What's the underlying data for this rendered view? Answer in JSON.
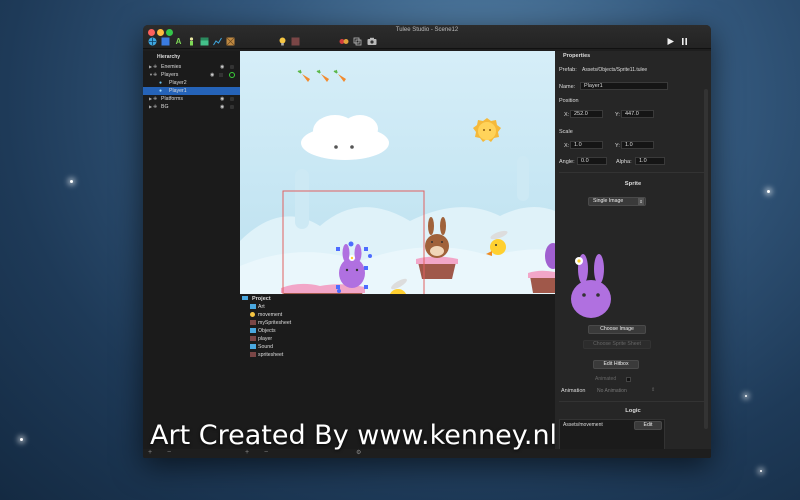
{
  "window": {
    "title": "Tulee Studio - Scene12"
  },
  "toolbar": {
    "tools": [
      {
        "icon": "globe-icon",
        "color": "#3fa7e0"
      },
      {
        "icon": "square-icon",
        "color": "#3a7be0"
      },
      {
        "icon": "letter-a-icon",
        "color": "#7ed957"
      },
      {
        "icon": "figure-icon",
        "color": "#7ed957"
      },
      {
        "icon": "tile-icon",
        "color": "#43c08a"
      },
      {
        "icon": "line-icon",
        "color": "#3fa7e0"
      },
      {
        "icon": "crate-icon",
        "color": "#c08a43"
      }
    ],
    "extra": [
      {
        "icon": "lightbulb-icon",
        "color": "#f5c542"
      },
      {
        "icon": "spritesheet-icon",
        "color": "#7a4646"
      },
      {
        "icon": "collision-icon",
        "color": "#d23c3c"
      },
      {
        "icon": "layers-icon",
        "color": "#bbbbbb"
      },
      {
        "icon": "camera-icon",
        "color": "#bbbbbb"
      }
    ],
    "play_icon": "play-icon",
    "pause_icon": "pause-icon"
  },
  "hierarchy": {
    "title": "Hierarchy",
    "items": [
      {
        "label": "Enemies",
        "level": 0,
        "expandable": true
      },
      {
        "label": "Players",
        "level": 0,
        "expandable": true
      },
      {
        "label": "Player2",
        "level": 1,
        "expandable": false
      },
      {
        "label": "Player1",
        "level": 1,
        "expandable": false,
        "selected": true
      },
      {
        "label": "Platforms",
        "level": 0,
        "expandable": true
      },
      {
        "label": "BG",
        "level": 0,
        "expandable": true
      }
    ]
  },
  "project": {
    "title": "Project",
    "items": [
      {
        "label": "Art",
        "type": "folder"
      },
      {
        "label": "movement",
        "type": "script"
      },
      {
        "label": "mySpritesheet",
        "type": "spritesheet"
      },
      {
        "label": "Objects",
        "type": "folder"
      },
      {
        "label": "player",
        "type": "spritesheet"
      },
      {
        "label": "Sound",
        "type": "folder"
      },
      {
        "label": "spritesheet",
        "type": "spritesheet"
      }
    ]
  },
  "properties": {
    "title": "Properties",
    "prefab_label": "Prefab:",
    "prefab_value": "Assets/Objects/Sprite11.tulee",
    "name_label": "Name:",
    "name_value": "Player1",
    "position_label": "Position",
    "pos_x_label": "X:",
    "pos_x": "252.0",
    "pos_y_label": "Y:",
    "pos_y": "447.0",
    "scale_label": "Scale",
    "scale_x_label": "X:",
    "scale_x": "1.0",
    "scale_y_label": "Y:",
    "scale_y": "1.0",
    "angle_label": "Angle:",
    "angle": "0.0",
    "alpha_label": "Alpha:",
    "alpha": "1.0",
    "sprite_section": "Sprite",
    "sprite_mode": "Single Image",
    "choose_image": "Choose Image",
    "choose_sprite_sheet": "Choose Sprite Sheet",
    "edit_hitbox": "Edit Hitbox",
    "animated_label": "Animated",
    "animation_label": "Animation",
    "animation_value": "No Animation",
    "logic_section": "Logic",
    "logic_script": "Assets/movement",
    "edit_button": "Edit"
  },
  "footer": {
    "plus": "+",
    "minus": "−",
    "gear": "⚙"
  },
  "credit": "Art Created By www.kenney.nl",
  "colors": {
    "accent": "#2563b8",
    "selection": "#e06060",
    "handle": "#4d6cff"
  }
}
